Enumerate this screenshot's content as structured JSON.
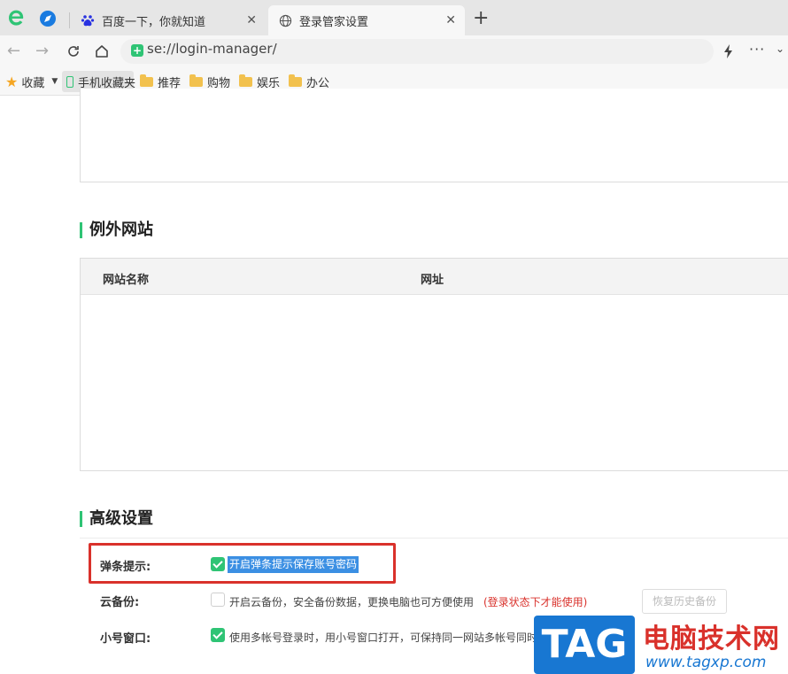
{
  "tabs": [
    {
      "title": "百度一下，你就知道",
      "icon": "baidu-paw-icon",
      "active": false
    },
    {
      "title": "登录管家设置",
      "icon": "globe-icon",
      "active": true
    }
  ],
  "address": {
    "url": "se://login-manager/"
  },
  "bookmarks": {
    "favorites_label": "收藏",
    "mobile_label": "手机收藏夹",
    "folders": [
      "推荐",
      "购物",
      "娱乐",
      "办公"
    ]
  },
  "exceptions": {
    "title": "例外网站",
    "col_name": "网站名称",
    "col_url": "网址"
  },
  "advanced": {
    "title": "高级设置",
    "popup": {
      "label": "弹条提示:",
      "text": "开启弹条提示保存账号密码",
      "checked": true
    },
    "cloud": {
      "label": "云备份:",
      "text": "开启云备份，安全备份数据，更换电脑也可方便使用",
      "note": "(登录状态下才能使用)",
      "checked": false,
      "button": "恢复历史备份"
    },
    "small": {
      "label": "小号窗口:",
      "text": "使用多帐号登录时，用小号窗口打开，可保持同一网站多帐号同时",
      "checked": true
    }
  },
  "watermark": {
    "tag": "TAG",
    "cn": "电脑技术网",
    "url": "www.tagxp.com"
  },
  "colors": {
    "accent": "#2fc475",
    "highlight": "#d9312b",
    "selection": "#3b8fe3"
  }
}
